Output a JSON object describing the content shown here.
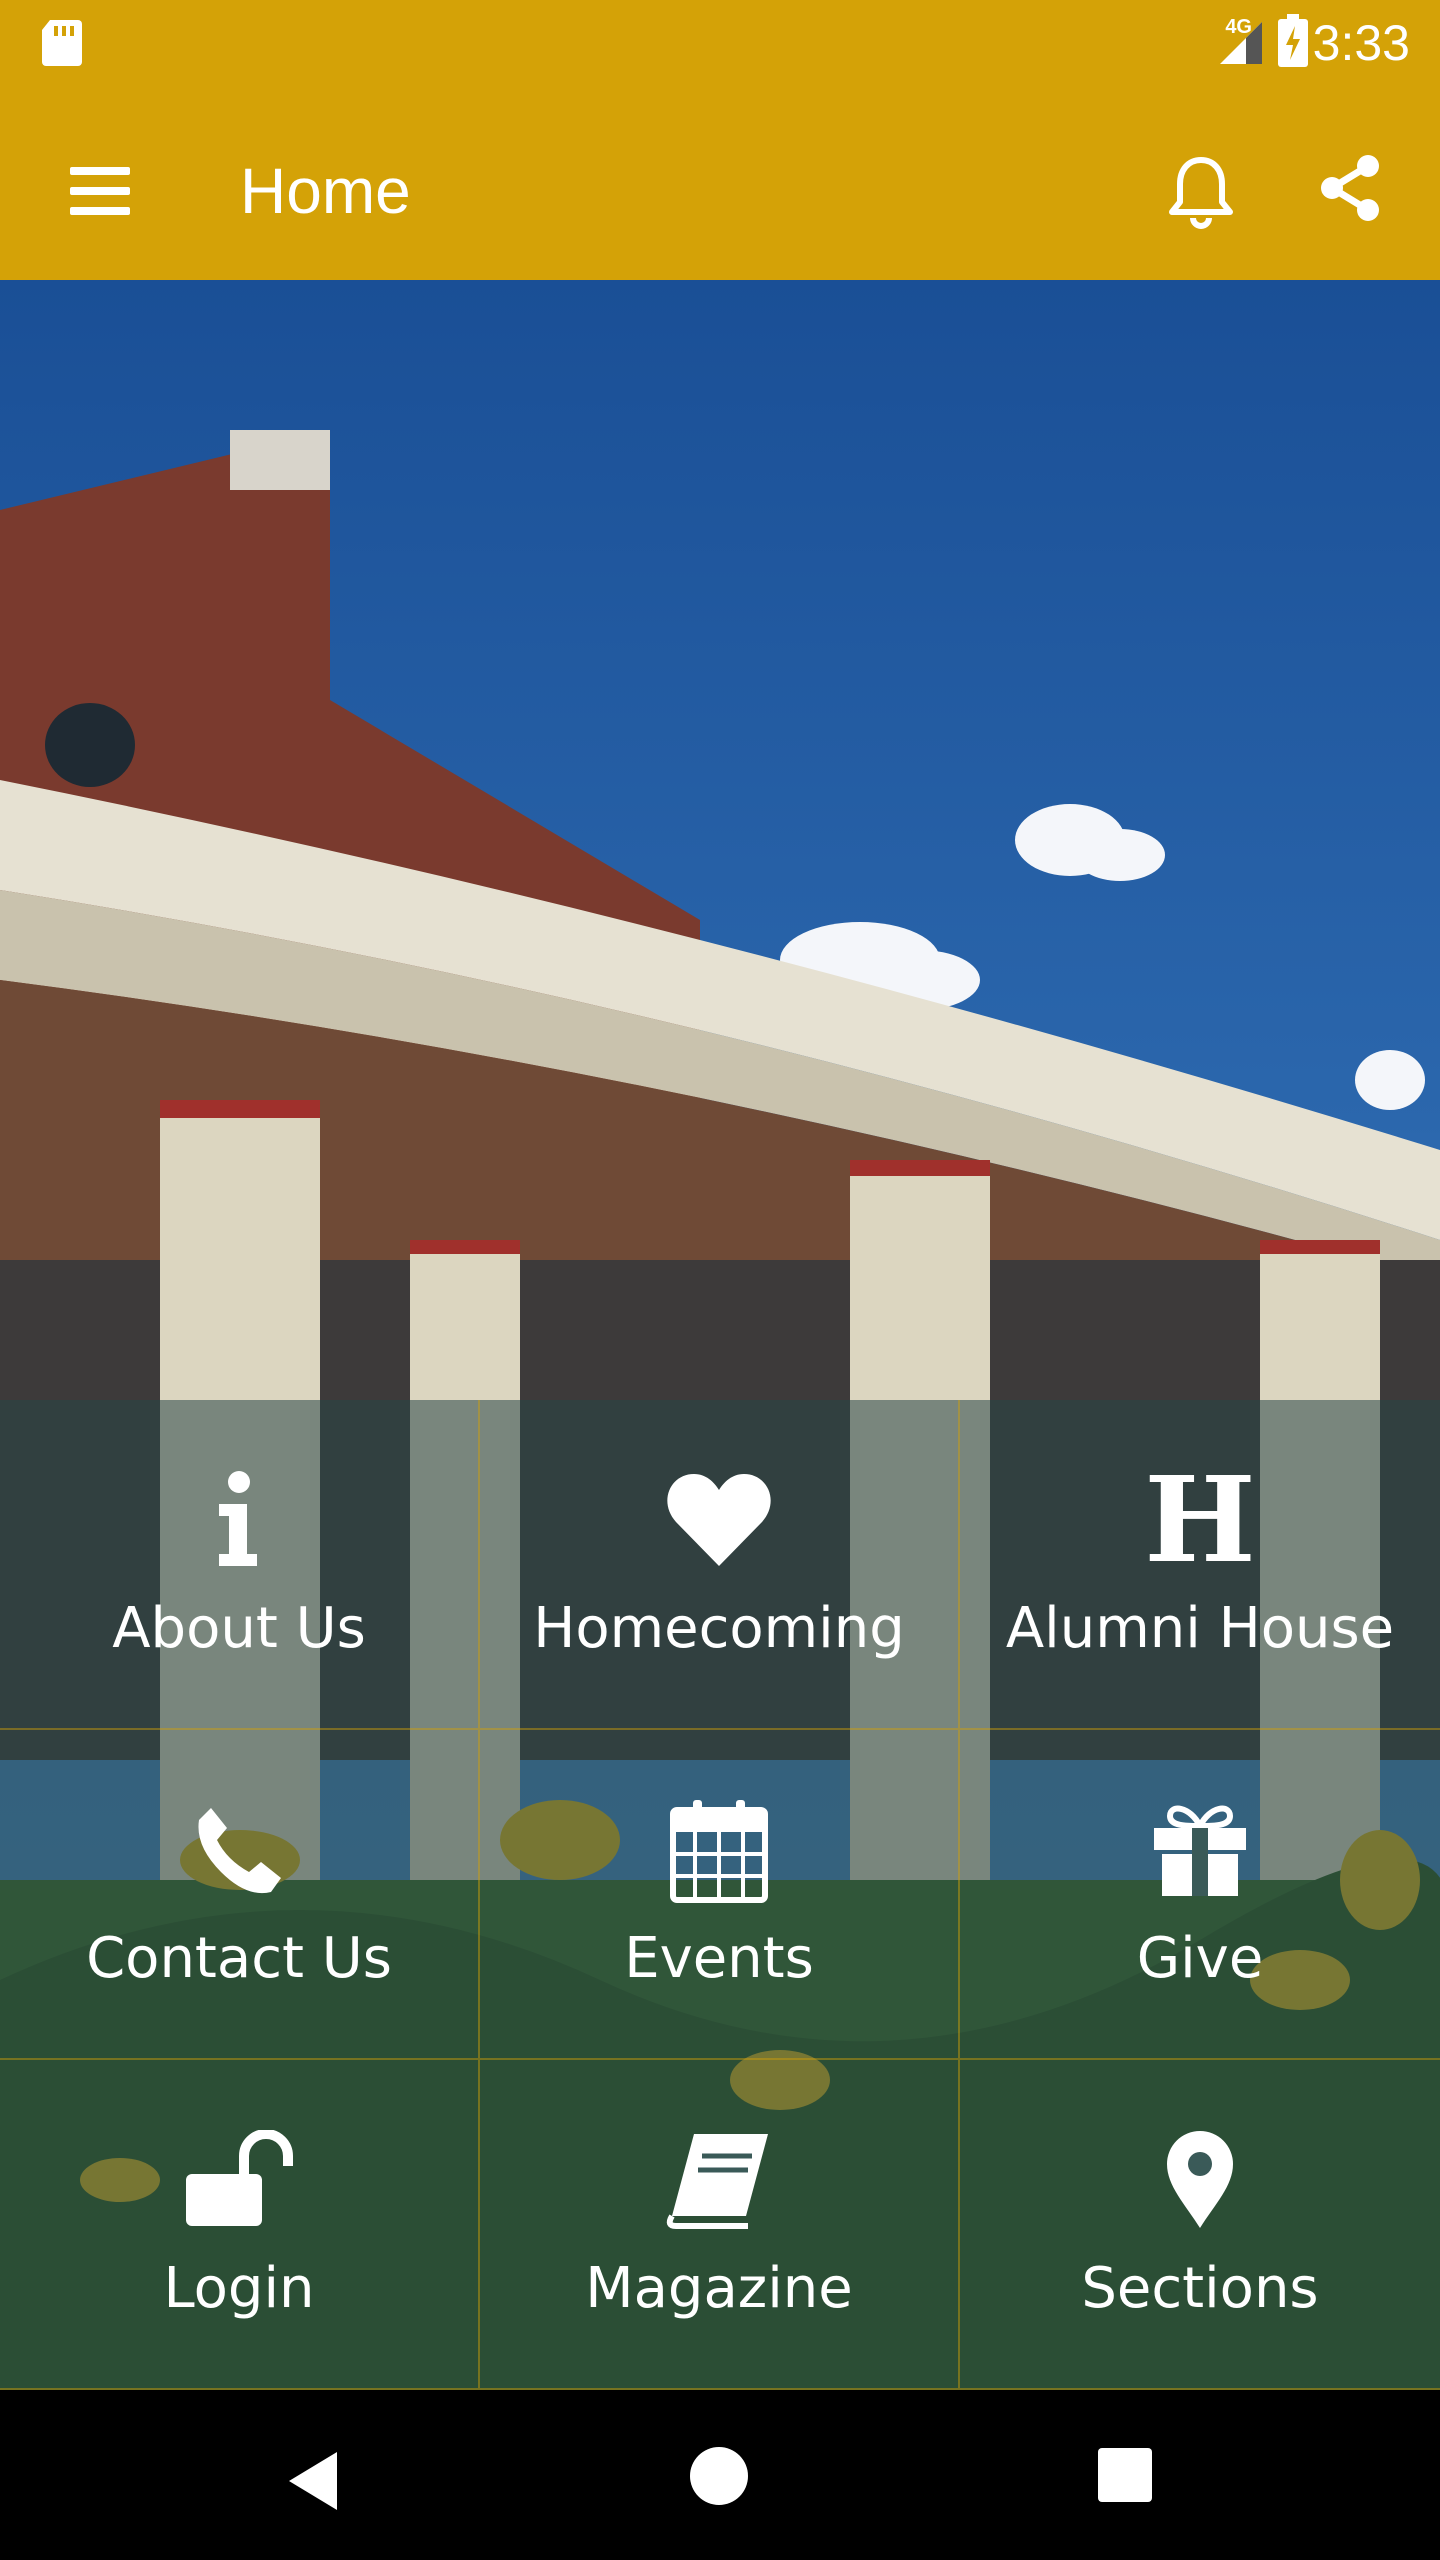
{
  "status_bar": {
    "time": "3:33",
    "network": "4G"
  },
  "toolbar": {
    "title": "Home"
  },
  "tiles": [
    {
      "label": "About Us",
      "icon": "info-icon"
    },
    {
      "label": "Homecoming",
      "icon": "heart-icon"
    },
    {
      "label": "Alumni House",
      "icon": "letter-h-icon",
      "glyph": "H"
    },
    {
      "label": "Contact Us",
      "icon": "phone-icon"
    },
    {
      "label": "Events",
      "icon": "calendar-icon"
    },
    {
      "label": "Give",
      "icon": "gift-icon"
    },
    {
      "label": "Login",
      "icon": "unlock-icon"
    },
    {
      "label": "Magazine",
      "icon": "book-icon"
    },
    {
      "label": "Sections",
      "icon": "map-pin-icon"
    }
  ],
  "colors": {
    "brand": "#d4a207",
    "tile_overlay": "#284646",
    "divider": "#d4a207"
  }
}
